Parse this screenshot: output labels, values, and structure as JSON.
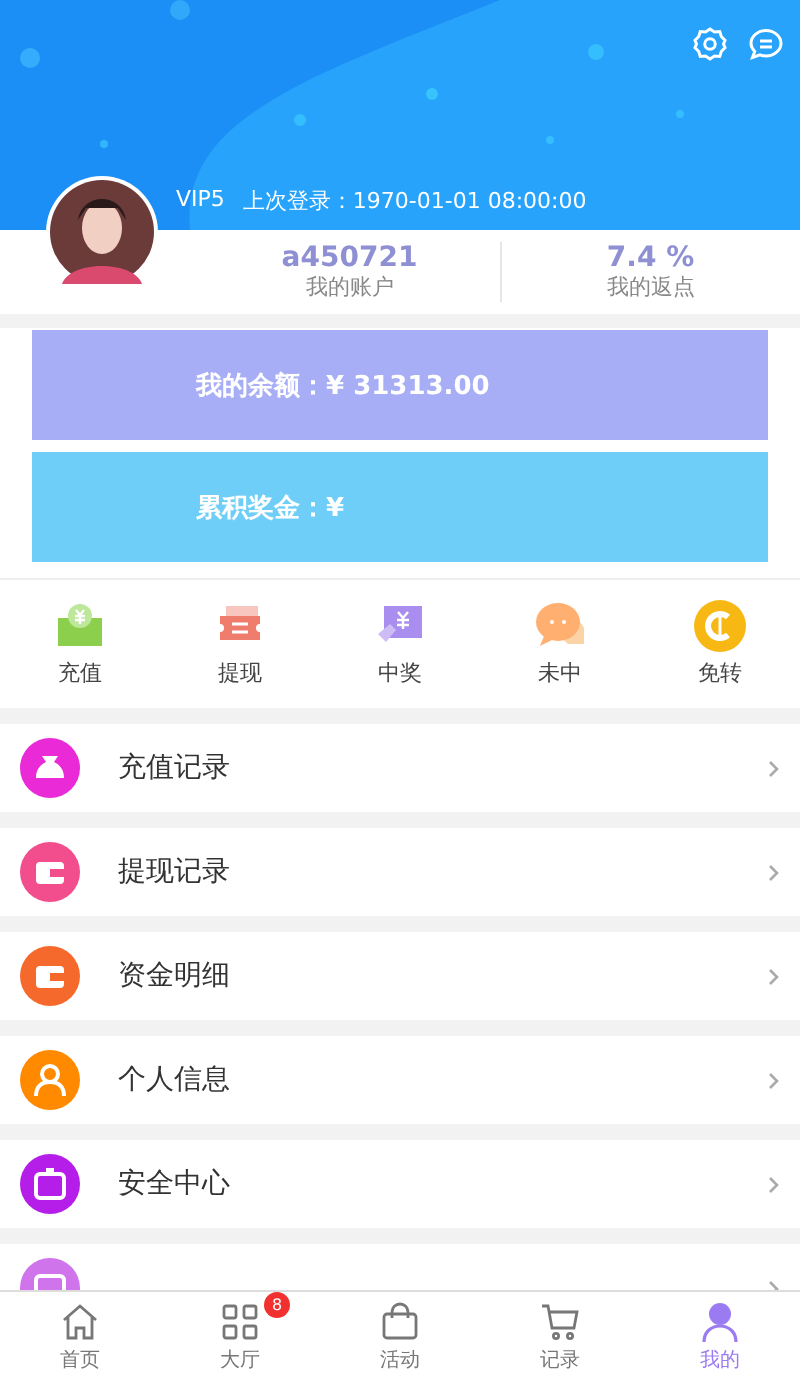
{
  "header": {
    "vip": "VIP5",
    "last_login": "上次登录：1970-01-01 08:00:00"
  },
  "stats": [
    {
      "value": "a450721",
      "label": "我的账户"
    },
    {
      "value": "7.4 %",
      "label": "我的返点"
    }
  ],
  "balance_cards": [
    {
      "text": "我的余额：¥ 31313.00",
      "color": "#a8aef5"
    },
    {
      "text": "累积奖金：¥",
      "color": "#6ecef7"
    }
  ],
  "quick_actions": [
    {
      "label": "充值",
      "kind": "deposit"
    },
    {
      "label": "提现",
      "kind": "withdraw"
    },
    {
      "label": "中奖",
      "kind": "win"
    },
    {
      "label": "未中",
      "kind": "lose"
    },
    {
      "label": "免转",
      "kind": "transfer"
    }
  ],
  "menu": [
    {
      "label": "充值记录",
      "kind": "bag",
      "color": "#e92ad6"
    },
    {
      "label": "提现记录",
      "kind": "wallet",
      "color": "#f24d8c"
    },
    {
      "label": "资金明细",
      "kind": "wallet",
      "color": "#f5692c"
    },
    {
      "label": "个人信息",
      "kind": "person",
      "color": "#ff8a00"
    },
    {
      "label": "安全中心",
      "kind": "safe",
      "color": "#b41ee8"
    },
    {
      "kind": "gift",
      "color": "#cf74ea"
    }
  ],
  "tab_bar": [
    {
      "label": "首页",
      "kind": "home",
      "selected": false
    },
    {
      "label": "大厅",
      "kind": "grid",
      "selected": false,
      "badge": "8"
    },
    {
      "label": "活动",
      "kind": "bag",
      "selected": false
    },
    {
      "label": "记录",
      "kind": "cart",
      "selected": false
    },
    {
      "label": "我的",
      "kind": "person",
      "selected": true
    }
  ]
}
